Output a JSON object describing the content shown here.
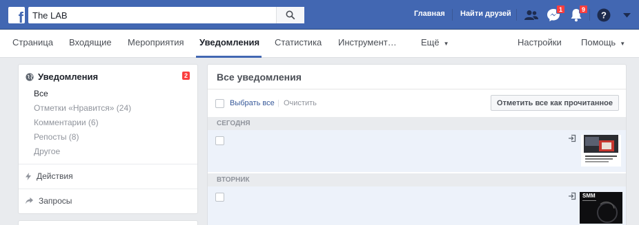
{
  "topbar": {
    "logo_letter": "f",
    "search_value": "The LAB",
    "home_label": "Главная",
    "find_friends_label": "Найти друзей",
    "messages_count": "1",
    "notifications_count": "9"
  },
  "subnav": {
    "tabs": [
      "Страница",
      "Входящие",
      "Мероприятия",
      "Уведомления",
      "Статистика",
      "Инструмент…",
      "Ещё"
    ],
    "settings_label": "Настройки",
    "help_label": "Помощь"
  },
  "sidebar": {
    "title": "Уведомления",
    "count": "2",
    "items": [
      "Все",
      "Отметки «Нравится» (24)",
      "Комментарии (6)",
      "Репосты (8)",
      "Другое"
    ],
    "actions_label": "Действия",
    "requests_label": "Запросы"
  },
  "main": {
    "title": "Все уведомления",
    "select_all_label": "Выбрать все",
    "clear_label": "Очистить",
    "mark_all_read_label": "Отметить все как прочитанное",
    "sections": [
      {
        "label": "СЕГОДНЯ"
      },
      {
        "label": "ВТОРНИК"
      }
    ],
    "thumb2_text": "SMM"
  },
  "colors": {
    "brand_blue": "#4267b2",
    "badge_red": "#fa3e3e",
    "link_blue": "#365899"
  }
}
